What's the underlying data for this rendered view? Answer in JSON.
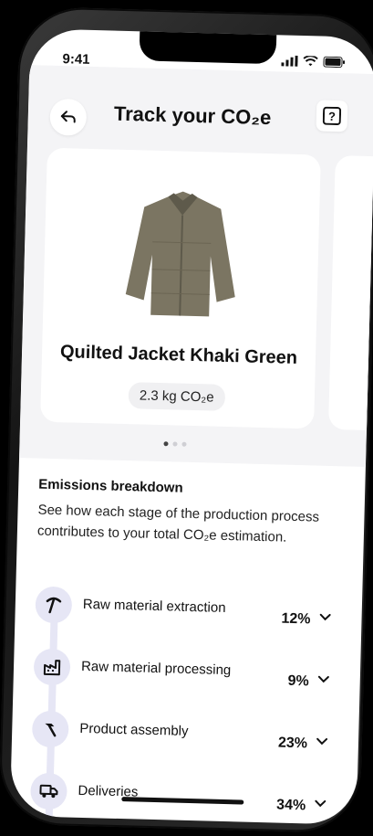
{
  "status": {
    "time": "9:41"
  },
  "header": {
    "title": "Track your CO₂e"
  },
  "product": {
    "name": "Quilted Jacket Khaki Green",
    "co2": "2.3 kg CO₂e",
    "image_color": "#7b7562"
  },
  "pager": {
    "current": 1,
    "total": 3
  },
  "breakdown": {
    "title": "Emissions breakdown",
    "description": "See how each stage of the production process contributes to your total CO₂e estimation."
  },
  "stages": [
    {
      "label": "Raw material extraction",
      "percent": "12%",
      "icon": "pickaxe-icon"
    },
    {
      "label": "Raw material processing",
      "percent": "9%",
      "icon": "factory-icon"
    },
    {
      "label": "Product assembly",
      "percent": "23%",
      "icon": "hammer-icon"
    },
    {
      "label": "Deliveries",
      "percent": "34%",
      "icon": "truck-icon"
    }
  ],
  "colors": {
    "accent_light": "#e6e6f5",
    "background": "#f4f4f6",
    "text": "#111111"
  }
}
